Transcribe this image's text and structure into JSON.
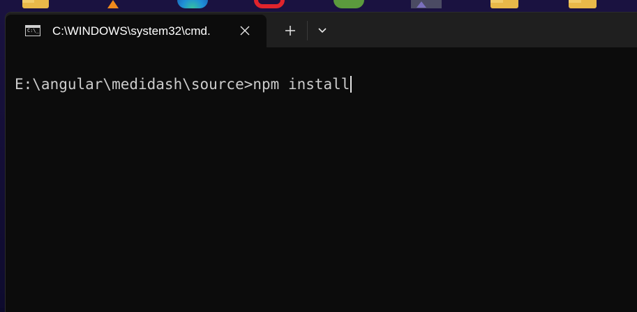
{
  "desktop": {
    "icons": [
      "folder-icon",
      "vlc-icon",
      "edge-icon",
      "opera-icon",
      "android-icon",
      "pinned-app-icon",
      "folder-icon",
      "folder-icon"
    ]
  },
  "window": {
    "tab": {
      "icon": "cmd-icon",
      "icon_glyph": "C:\\_",
      "title": "C:\\WINDOWS\\system32\\cmd.",
      "close_glyph": "✕"
    },
    "new_tab_glyph": "+",
    "dropdown_glyph": "⌄"
  },
  "terminal": {
    "prompt": "E:\\angular\\medidash\\source>",
    "command": "npm install",
    "foreground": "#cccccc",
    "background": "#0c0c0c"
  }
}
